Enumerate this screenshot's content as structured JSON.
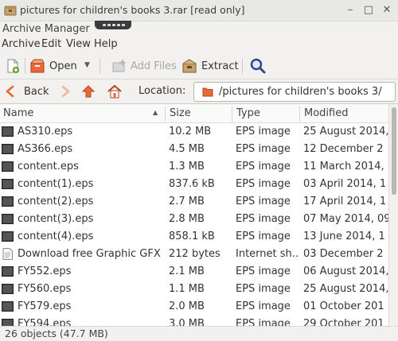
{
  "window": {
    "title": "pictures for children's books 3.rar [read only]",
    "app_name": "Archive Manager"
  },
  "menubar": [
    "Archive",
    "Edit",
    "View",
    "Help"
  ],
  "toolbar": {
    "open_label": "Open",
    "add_files_label": "Add Files",
    "extract_label": "Extract"
  },
  "nav": {
    "back_label": "Back",
    "location_label": "Location:",
    "location_path": "/pictures for children's books 3/"
  },
  "columns": [
    "Name",
    "Size",
    "Type",
    "Modified"
  ],
  "rows": [
    {
      "name": "AS310.eps",
      "size": "10.2 MB",
      "type": "EPS image",
      "modified": "25 August 2014, 1",
      "icon": "image"
    },
    {
      "name": "AS366.eps",
      "size": "4.5 MB",
      "type": "EPS image",
      "modified": "12 December 2",
      "icon": "image"
    },
    {
      "name": "content.eps",
      "size": "1.3 MB",
      "type": "EPS image",
      "modified": "11 March 2014, 1",
      "icon": "image"
    },
    {
      "name": "content(1).eps",
      "size": "837.6 kB",
      "type": "EPS image",
      "modified": "03 April 2014, 1",
      "icon": "image"
    },
    {
      "name": "content(2).eps",
      "size": "2.7 MB",
      "type": "EPS image",
      "modified": "17 April 2014, 1",
      "icon": "image"
    },
    {
      "name": "content(3).eps",
      "size": "2.8 MB",
      "type": "EPS image",
      "modified": "07 May 2014, 09",
      "icon": "image"
    },
    {
      "name": "content(4).eps",
      "size": "858.1 kB",
      "type": "EPS image",
      "modified": "13 June 2014, 1",
      "icon": "image"
    },
    {
      "name": "Download free Graphic GFX s…",
      "size": "212 bytes",
      "type": "Internet sh…",
      "modified": "03 December 2",
      "icon": "document"
    },
    {
      "name": "FY552.eps",
      "size": "2.1 MB",
      "type": "EPS image",
      "modified": "06 August 2014,",
      "icon": "image"
    },
    {
      "name": "FY560.eps",
      "size": "1.1 MB",
      "type": "EPS image",
      "modified": "25 August 2014,",
      "icon": "image"
    },
    {
      "name": "FY579.eps",
      "size": "2.0 MB",
      "type": "EPS image",
      "modified": "01 October 201",
      "icon": "image"
    },
    {
      "name": "FY594.eps",
      "size": "3.0 MB",
      "type": "EPS image",
      "modified": "29 October 201",
      "icon": "image"
    }
  ],
  "status": "26 objects (47.7 MB)",
  "colors": {
    "accent_orange": "#e9683a",
    "selection_none": "#ffffff"
  }
}
